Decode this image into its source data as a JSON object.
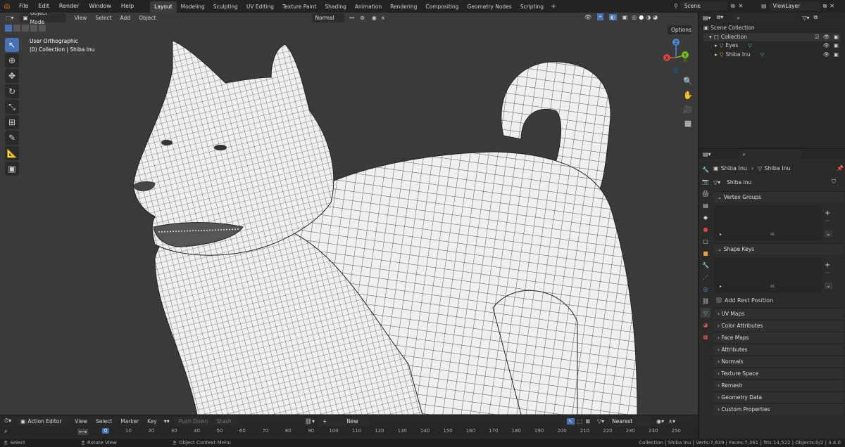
{
  "topbar": {
    "menus": [
      "File",
      "Edit",
      "Render",
      "Window",
      "Help"
    ],
    "tabs": [
      "Layout",
      "Modeling",
      "Sculpting",
      "UV Editing",
      "Texture Paint",
      "Shading",
      "Animation",
      "Rendering",
      "Compositing",
      "Geometry Nodes",
      "Scripting"
    ],
    "add_tab": "+",
    "scene": "Scene",
    "view_layer": "ViewLayer"
  },
  "viewport": {
    "mode": "Object Mode",
    "menus": [
      "View",
      "Select",
      "Add",
      "Object"
    ],
    "orientation": "Normal",
    "overlay_title": "User Orthographic",
    "overlay_subtitle": "(0) Collection | Shiba Inu",
    "options": "Options",
    "axes": {
      "x": "X",
      "y": "Y",
      "z": "Z"
    }
  },
  "outliner": {
    "search_placeholder": "",
    "scene_collection": "Scene Collection",
    "collection": "Collection",
    "items": [
      "Eyes",
      "Shiba Inu"
    ]
  },
  "properties": {
    "breadcrumb_object": "Shiba Inu",
    "breadcrumb_data": "Shiba Inu",
    "mesh_name": "Shiba Inu",
    "panels": {
      "vertex_groups": "Vertex Groups",
      "shape_keys": "Shape Keys",
      "add_rest_position": "Add Rest Position",
      "collapsed": [
        "UV Maps",
        "Color Attributes",
        "Face Maps",
        "Attributes",
        "Normals",
        "Texture Space",
        "Remesh",
        "Geometry Data",
        "Custom Properties"
      ]
    }
  },
  "timeline": {
    "editor": "Action Editor",
    "menus": [
      "View",
      "Select",
      "Marker",
      "Key"
    ],
    "push_down": "Push Down",
    "stash": "Stash",
    "new_label": "New",
    "interpolation": "Nearest Frame",
    "current_frame": "0",
    "ruler": [
      "0",
      "10",
      "20",
      "30",
      "40",
      "50",
      "60",
      "70",
      "80",
      "90",
      "100",
      "110",
      "120",
      "130",
      "140",
      "150",
      "160",
      "170",
      "180",
      "190",
      "200",
      "210",
      "220",
      "230",
      "240",
      "250"
    ]
  },
  "status": {
    "left1": "Select",
    "left2": "Rotate View",
    "left3": "Object Context Menu",
    "right": "Collection | Shiba Inu | Verts:7,639 | Faces:7,361 | Tris:14,522 | Objects:0/2 | 3.4.0"
  }
}
